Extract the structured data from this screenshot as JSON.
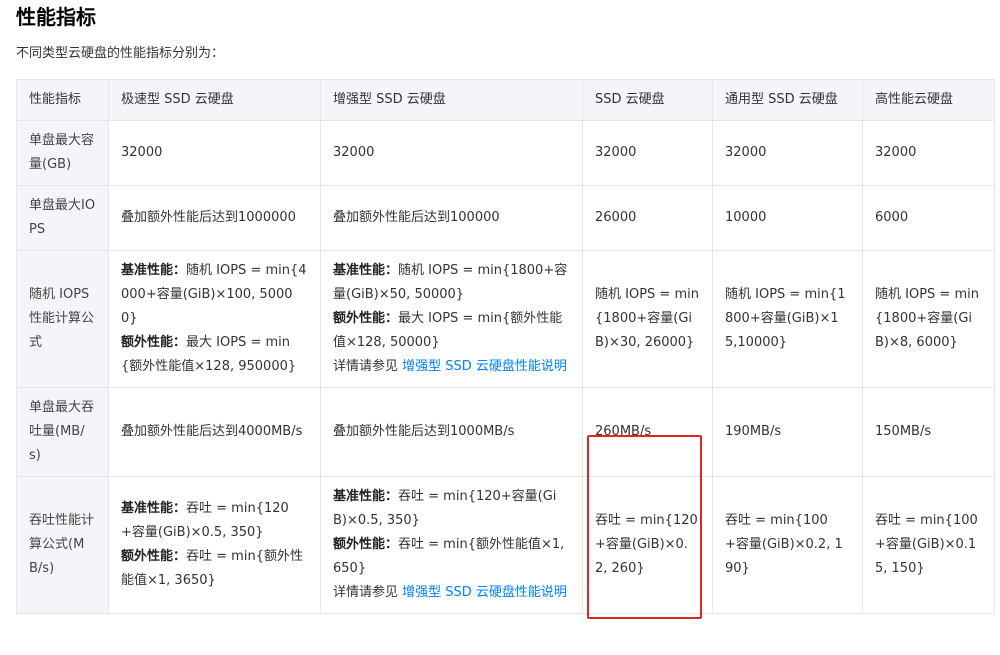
{
  "title": "性能指标",
  "intro": "不同类型云硬盘的性能指标分别为：",
  "table": {
    "headers": [
      "性能指标",
      "极速型 SSD 云硬盘",
      "增强型 SSD 云硬盘",
      "SSD 云硬盘",
      "通用型 SSD 云硬盘",
      "高性能云硬盘"
    ],
    "rows": {
      "capacity": {
        "label": "单盘最大容量(GB)",
        "cells": [
          "32000",
          "32000",
          "32000",
          "32000",
          "32000"
        ]
      },
      "iops": {
        "label": "单盘最大IOPS",
        "cells": [
          "叠加额外性能后达到1000000",
          "叠加额外性能后达到100000",
          "26000",
          "10000",
          "6000"
        ]
      },
      "iops_formula": {
        "label": "随机 IOPS 性能计算公式",
        "extreme": {
          "base_label": "基准性能：",
          "base_text": "随机 IOPS = min{4000+容量(GiB)×100, 50000}",
          "extra_label": "额外性能：",
          "extra_text": "最大 IOPS = min{额外性能值×128, 950000}"
        },
        "enhanced": {
          "base_label": "基准性能：",
          "base_text": "随机 IOPS = min{1800+容量(GiB)×50, 50000}",
          "extra_label": "额外性能：",
          "extra_text": "最大 IOPS = min{额外性能值×128, 50000}",
          "see_text": "详情请参见 ",
          "link_text": "增强型 SSD 云硬盘性能说明"
        },
        "ssd": "随机 IOPS = min{1800+容量(GiB)×30, 26000}",
        "general": "随机 IOPS = min{1800+容量(GiB)×15,10000}",
        "premium": "随机 IOPS = min{1800+容量(GiB)×8, 6000}"
      },
      "throughput": {
        "label": "单盘最大吞吐量(MB/s)",
        "cells": [
          "叠加额外性能后达到4000MB/s",
          "叠加额外性能后达到1000MB/s",
          "260MB/s",
          "190MB/s",
          "150MB/s"
        ]
      },
      "throughput_formula": {
        "label": "吞吐性能计算公式(MB/s)",
        "extreme": {
          "base_label": "基准性能：",
          "base_text": "吞吐 = min{120+容量(GiB)×0.5, 350}",
          "extra_label": "额外性能：",
          "extra_text": "吞吐 = min{额外性能值×1, 3650}"
        },
        "enhanced": {
          "base_label": "基准性能：",
          "base_text": "吞吐 = min{120+容量(GiB)×0.5, 350}",
          "extra_label": "额外性能：",
          "extra_text": "吞吐 = min{额外性能值×1, 650}",
          "see_text": "详情请参见 ",
          "link_text": "增强型 SSD 云硬盘性能说明"
        },
        "ssd": "吞吐 = min{120+容量(GiB)×0.2, 260}",
        "general": "吞吐 = min{100+容量(GiB)×0.2, 190}",
        "premium": "吞吐 = min{100+容量(GiB)×0.15, 150}"
      }
    }
  },
  "colors": {
    "link": "#0080ff",
    "highlight": "#e0261f",
    "header_bg": "#f3f5f8",
    "border": "#e4e6eb"
  }
}
